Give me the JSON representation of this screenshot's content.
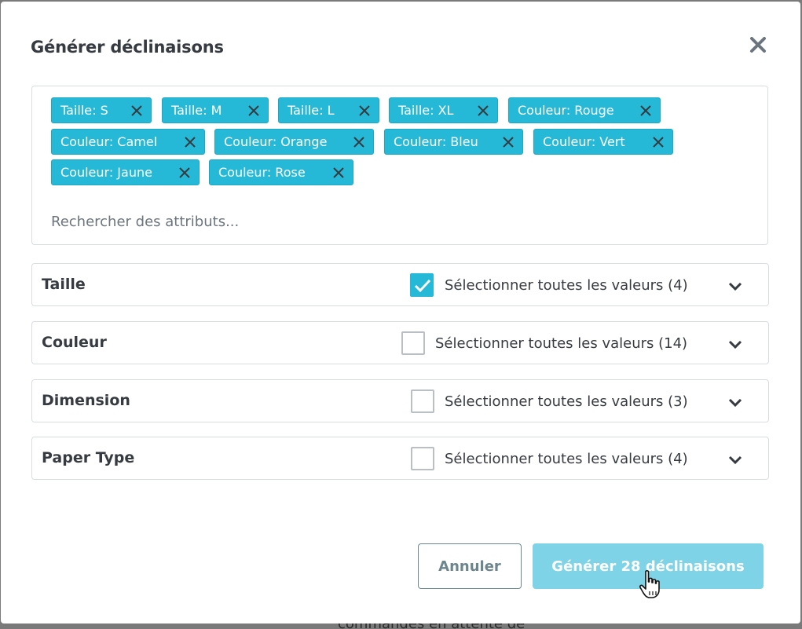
{
  "background": {
    "partial_text": "commandes en attente de"
  },
  "modal": {
    "title": "Générer déclinaisons",
    "close_icon": "close-icon"
  },
  "tags": [
    {
      "label": "Taille: S"
    },
    {
      "label": "Taille: M"
    },
    {
      "label": "Taille: L"
    },
    {
      "label": "Taille: XL"
    },
    {
      "label": "Couleur: Rouge"
    },
    {
      "label": "Couleur: Camel"
    },
    {
      "label": "Couleur: Orange"
    },
    {
      "label": "Couleur: Bleu"
    },
    {
      "label": "Couleur: Vert"
    },
    {
      "label": "Couleur: Jaune"
    },
    {
      "label": "Couleur: Rose"
    }
  ],
  "search": {
    "placeholder": "Rechercher des attributs...",
    "value": ""
  },
  "attribute_groups": [
    {
      "name": "Taille",
      "select_label": "Sélectionner toutes les valeurs (4)",
      "checked": true
    },
    {
      "name": "Couleur",
      "select_label": "Sélectionner toutes les valeurs (14)",
      "checked": false
    },
    {
      "name": "Dimension",
      "select_label": "Sélectionner toutes les valeurs (3)",
      "checked": false
    },
    {
      "name": "Paper Type",
      "select_label": "Sélectionner toutes les valeurs (4)",
      "checked": false
    }
  ],
  "footer": {
    "cancel_label": "Annuler",
    "generate_label": "Générer 28 déclinaisons"
  },
  "colors": {
    "accent": "#25b9d7",
    "accent_disabled": "#7fd3e6",
    "text": "#363a41",
    "secondary": "#6c868e",
    "border": "#d9dde3"
  }
}
